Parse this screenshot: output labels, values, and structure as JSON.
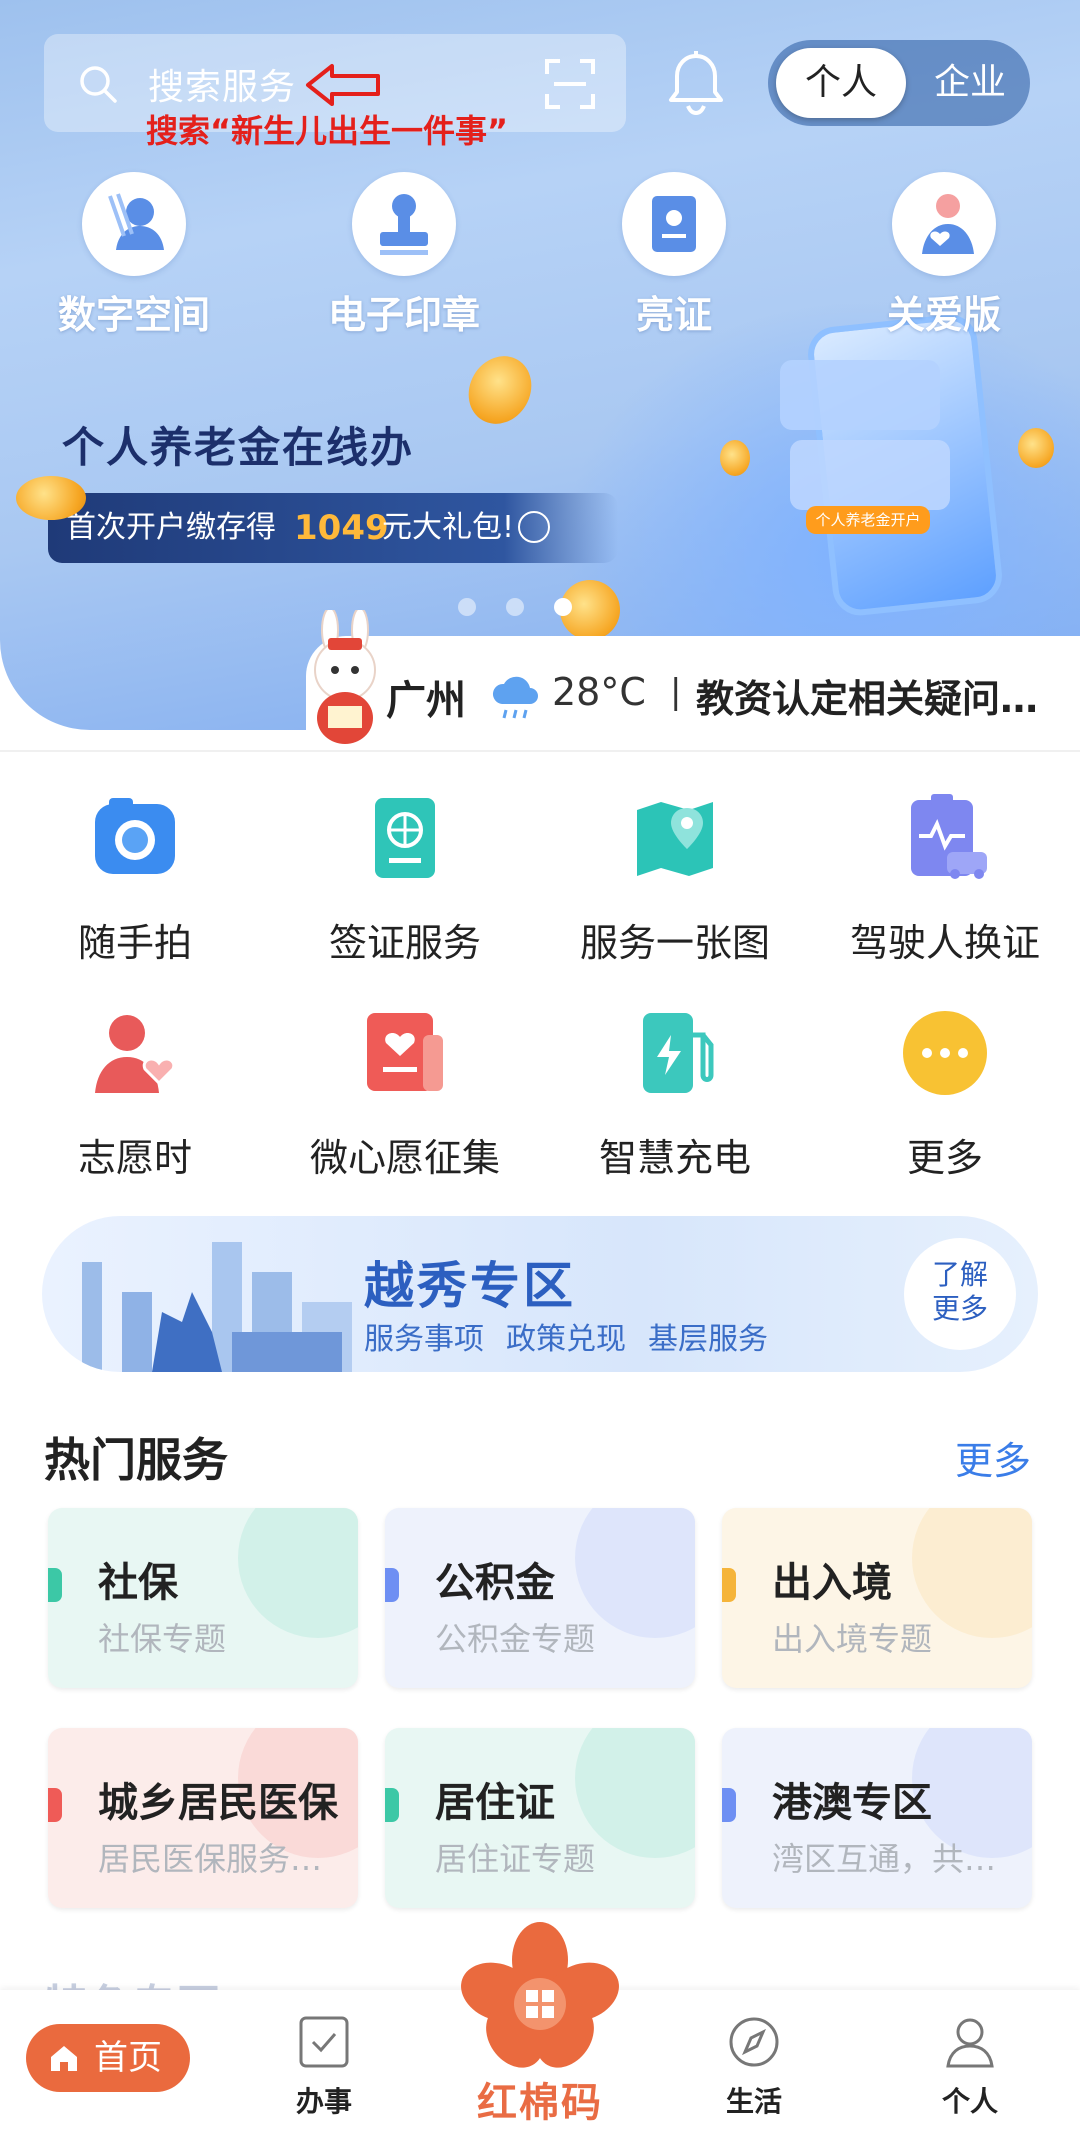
{
  "search": {
    "placeholder": "搜索服务",
    "annotation": "搜索“新生儿出生一件事”"
  },
  "toggle": {
    "personal": "个人",
    "enterprise": "企业"
  },
  "quick_actions": [
    {
      "label": "数字空间",
      "icon": "digital-space-icon"
    },
    {
      "label": "电子印章",
      "icon": "stamp-icon"
    },
    {
      "label": "亮证",
      "icon": "certificate-icon"
    },
    {
      "label": "关爱版",
      "icon": "care-icon"
    }
  ],
  "banner": {
    "title": "个人养老金在线办",
    "text1": "首次开户缴存得",
    "amount": "1049",
    "text2": "元大礼包!",
    "tag": "个人养老金开户",
    "page_count": 4,
    "active_page": 3
  },
  "weather": {
    "city": "广州",
    "temp": "28°C",
    "separator": "|",
    "news": "教资认定相关疑问…"
  },
  "services": [
    {
      "label": "随手拍",
      "icon": "camera-icon",
      "color": "#3b8cf0"
    },
    {
      "label": "签证服务",
      "icon": "passport-icon",
      "color": "#2fc5b8"
    },
    {
      "label": "服务一张图",
      "icon": "map-pin-icon",
      "color": "#2cc4b7"
    },
    {
      "label": "驾驶人换证",
      "icon": "driver-license-icon",
      "color": "#7e87f0"
    },
    {
      "label": "志愿时",
      "icon": "volunteer-icon",
      "color": "#e85a5a"
    },
    {
      "label": "微心愿征集",
      "icon": "wish-icon",
      "color": "#ef5b57"
    },
    {
      "label": "智慧充电",
      "icon": "charging-icon",
      "color": "#3cc8bd"
    },
    {
      "label": "更多",
      "icon": "more-dots-icon",
      "color": "#f8c233"
    }
  ],
  "zone": {
    "title": "越秀专区",
    "subs": [
      "服务事项",
      "政策兑现",
      "基层服务"
    ],
    "more_line1": "了解",
    "more_line2": "更多"
  },
  "hot": {
    "title": "热门服务",
    "more": "更多",
    "cards": [
      {
        "title": "社保",
        "sub": "社保专题",
        "accent": "#3cc8a6",
        "bg": "#e8f7f3"
      },
      {
        "title": "公积金",
        "sub": "公积金专题",
        "accent": "#6e8ff3",
        "bg": "#eef2fc"
      },
      {
        "title": "出入境",
        "sub": "出入境专题",
        "accent": "#f5b43a",
        "bg": "#fdf5e6"
      },
      {
        "title": "城乡居民医保",
        "sub": "居民医保服务…",
        "accent": "#ef5b57",
        "bg": "#fcecea"
      },
      {
        "title": "居住证",
        "sub": "居住证专题",
        "accent": "#3cc8a6",
        "bg": "#e8f7f3"
      },
      {
        "title": "港澳专区",
        "sub": "湾区互通，共…",
        "accent": "#6e8ff3",
        "bg": "#eef2fc"
      }
    ]
  },
  "next_section_peek": "特色专区",
  "tabbar": {
    "home": "首页",
    "work": "办事",
    "center": "红棉码",
    "life": "生活",
    "me": "个人"
  }
}
